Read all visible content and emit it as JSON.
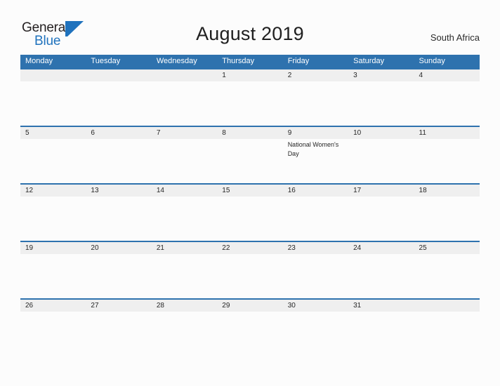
{
  "logo": {
    "line1": "General",
    "line2": "Blue",
    "mark": "blue-triangle-icon"
  },
  "header": {
    "title": "August 2019",
    "region": "South Africa"
  },
  "colors": {
    "header_blue": "#2e72ae",
    "date_band": "#efefef",
    "page_background": "#fcfcfc",
    "logo_blue": "#1f72bd",
    "text": "#262626"
  },
  "calendar": {
    "weekdays": [
      "Monday",
      "Tuesday",
      "Wednesday",
      "Thursday",
      "Friday",
      "Saturday",
      "Sunday"
    ],
    "weeks": [
      {
        "days": [
          {
            "num": "",
            "event": ""
          },
          {
            "num": "",
            "event": ""
          },
          {
            "num": "",
            "event": ""
          },
          {
            "num": "1",
            "event": ""
          },
          {
            "num": "2",
            "event": ""
          },
          {
            "num": "3",
            "event": ""
          },
          {
            "num": "4",
            "event": ""
          }
        ]
      },
      {
        "days": [
          {
            "num": "5",
            "event": ""
          },
          {
            "num": "6",
            "event": ""
          },
          {
            "num": "7",
            "event": ""
          },
          {
            "num": "8",
            "event": ""
          },
          {
            "num": "9",
            "event": "National Women's Day"
          },
          {
            "num": "10",
            "event": ""
          },
          {
            "num": "11",
            "event": ""
          }
        ]
      },
      {
        "days": [
          {
            "num": "12",
            "event": ""
          },
          {
            "num": "13",
            "event": ""
          },
          {
            "num": "14",
            "event": ""
          },
          {
            "num": "15",
            "event": ""
          },
          {
            "num": "16",
            "event": ""
          },
          {
            "num": "17",
            "event": ""
          },
          {
            "num": "18",
            "event": ""
          }
        ]
      },
      {
        "days": [
          {
            "num": "19",
            "event": ""
          },
          {
            "num": "20",
            "event": ""
          },
          {
            "num": "21",
            "event": ""
          },
          {
            "num": "22",
            "event": ""
          },
          {
            "num": "23",
            "event": ""
          },
          {
            "num": "24",
            "event": ""
          },
          {
            "num": "25",
            "event": ""
          }
        ]
      },
      {
        "days": [
          {
            "num": "26",
            "event": ""
          },
          {
            "num": "27",
            "event": ""
          },
          {
            "num": "28",
            "event": ""
          },
          {
            "num": "29",
            "event": ""
          },
          {
            "num": "30",
            "event": ""
          },
          {
            "num": "31",
            "event": ""
          },
          {
            "num": "",
            "event": ""
          }
        ]
      }
    ]
  }
}
